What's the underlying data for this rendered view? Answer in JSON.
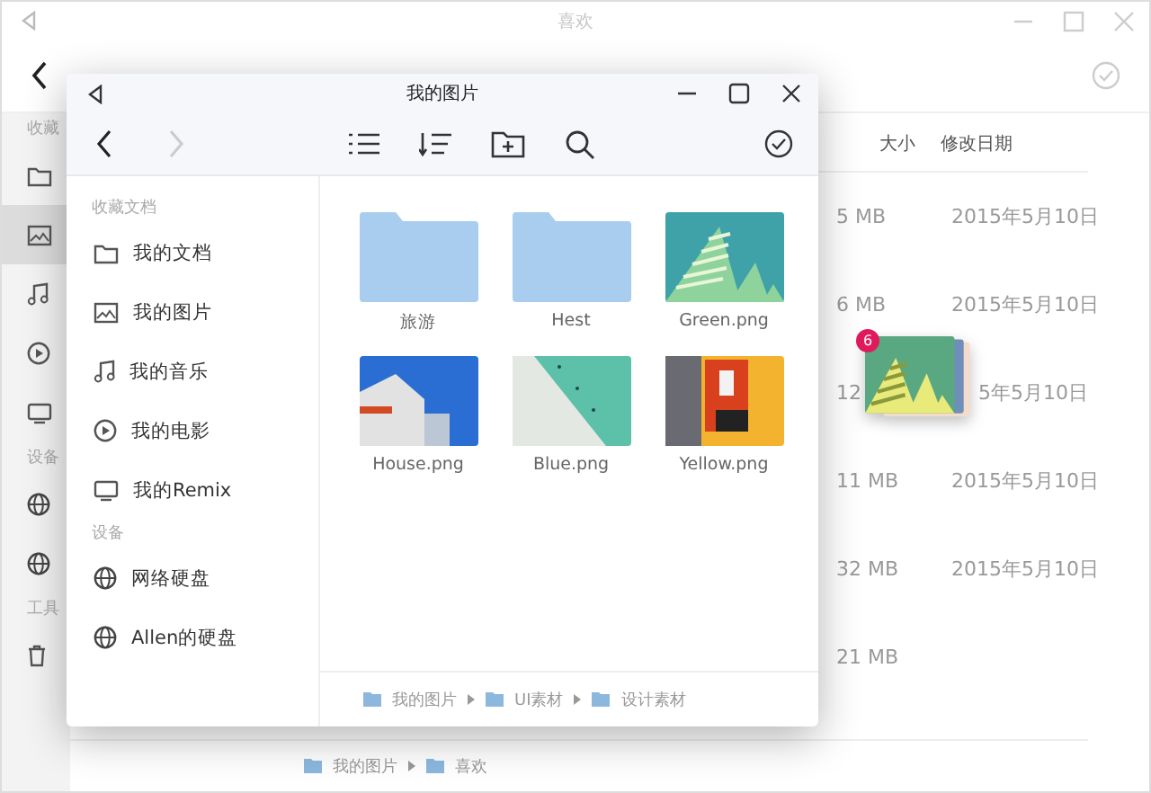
{
  "back_window": {
    "title": "喜欢",
    "rail": [
      {
        "label": "收藏",
        "items": [
          {
            "kind": "folder",
            "selected": false
          },
          {
            "kind": "image",
            "selected": true
          },
          {
            "kind": "music",
            "selected": false
          },
          {
            "kind": "play",
            "selected": false
          },
          {
            "kind": "monitor",
            "selected": false
          }
        ]
      },
      {
        "label": "设备",
        "items": [
          {
            "kind": "globe",
            "selected": false
          },
          {
            "kind": "globe",
            "selected": false
          }
        ]
      },
      {
        "label": "工具",
        "items": [
          {
            "kind": "trash",
            "selected": false
          }
        ]
      }
    ],
    "columns": [
      "大小",
      "修改日期"
    ],
    "rows": [
      {
        "size": "5 MB",
        "date": "2015年5月10日"
      },
      {
        "size": "6 MB",
        "date": "2015年5月10日"
      },
      {
        "size": "12",
        "date": "5年5月10日"
      },
      {
        "size": "11 MB",
        "date": "2015年5月10日"
      },
      {
        "size": "32 MB",
        "date": "2015年5月10日"
      },
      {
        "size": "21 MB",
        "date": ""
      }
    ],
    "breadcrumb": [
      "我的图片",
      "喜欢"
    ]
  },
  "front_window": {
    "title": "我的图片",
    "sidebar": [
      {
        "label": "收藏文档",
        "items": [
          {
            "kind": "folder",
            "label": "我的文档"
          },
          {
            "kind": "image",
            "label": "我的图片"
          },
          {
            "kind": "music",
            "label": "我的音乐"
          },
          {
            "kind": "play",
            "label": "我的电影"
          },
          {
            "kind": "monitor",
            "label": "我的Remix"
          }
        ]
      },
      {
        "label": "设备",
        "items": [
          {
            "kind": "globe",
            "label": "网络硬盘"
          },
          {
            "kind": "globe",
            "label": "Allen的硬盘"
          }
        ]
      }
    ],
    "files": [
      {
        "kind": "folder",
        "name": "旅游"
      },
      {
        "kind": "folder",
        "name": "Hest"
      },
      {
        "kind": "green",
        "name": "Green.png"
      },
      {
        "kind": "house",
        "name": "House.png"
      },
      {
        "kind": "blue",
        "name": "Blue.png"
      },
      {
        "kind": "yellow",
        "name": "Yellow.png"
      }
    ],
    "breadcrumb": [
      "我的图片",
      "UI素材",
      "设计素材"
    ]
  },
  "drag": {
    "count": "6"
  }
}
